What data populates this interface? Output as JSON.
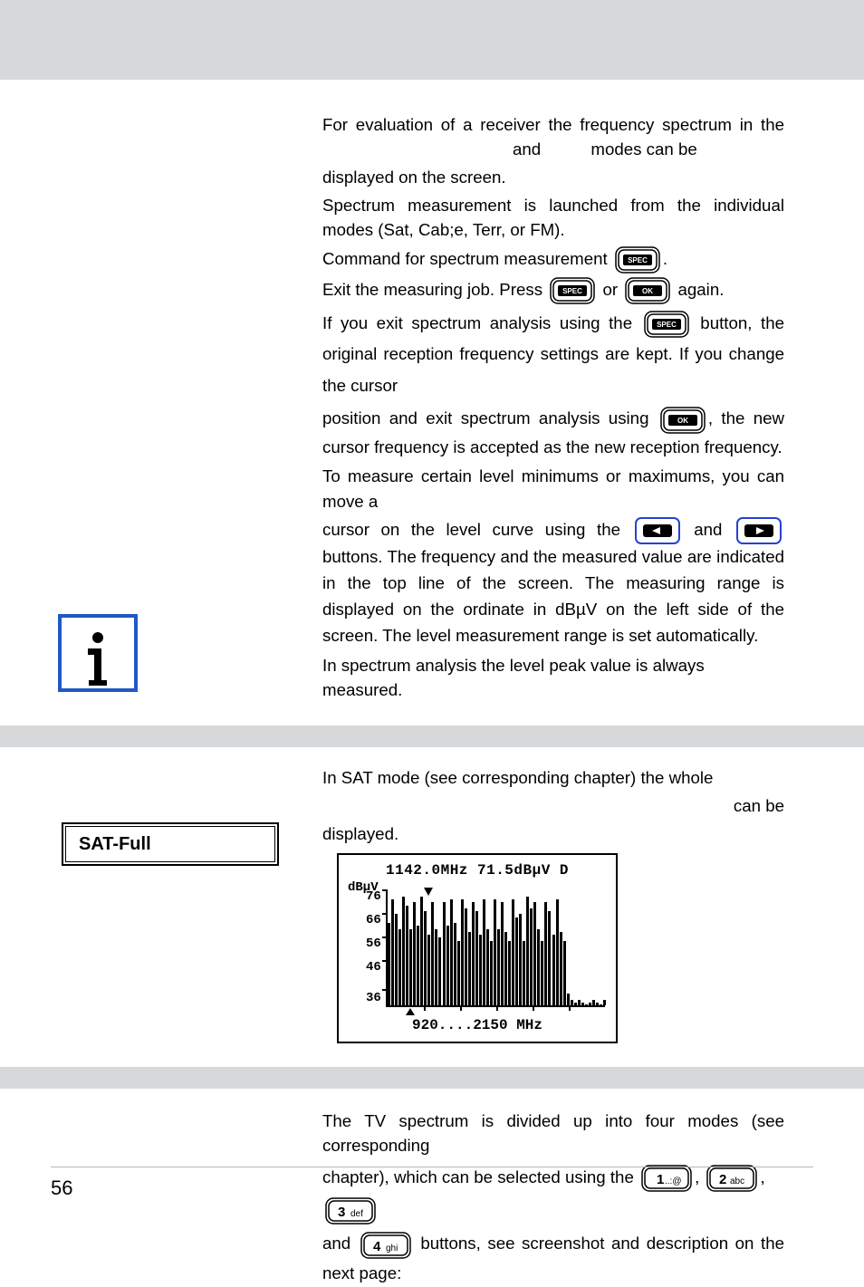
{
  "p1": "For evaluation of a receiver the frequency spectrum in the",
  "p1b": "and",
  "p1c": "modes can be",
  "p2": "displayed on the screen.",
  "p3": "Spectrum measurement is launched from the individual modes (Sat, Cab;e, Terr, or FM).",
  "p4": "Command for spectrum measurement",
  "p4dot": ".",
  "p5a": "Exit the measuring job. Press",
  "p5b": "or",
  "p5c": "again.",
  "p6a": "If you exit spectrum analysis using the",
  "p6b": "button, the original reception frequency settings are kept. If you change the cursor",
  "p7a": "position and exit spectrum analysis using",
  "p7b": ", the new cursor frequency is accepted as the new reception frequency.",
  "p8": "To measure certain level minimums or maximums, you can move a",
  "p9a": "cursor on the level curve using the",
  "p9b": "and",
  "p9c": "buttons. The frequency and the measured value are indicated in the top line of the screen. The measuring range is displayed on the ordinate in dBµV on the left side of the screen. The level measurement range is set automatically.",
  "p10": "In spectrum analysis the level peak value is always measured.",
  "p11": "In SAT mode (see corresponding chapter) the whole",
  "p11b": "can be",
  "p12": "displayed.",
  "sat_full_label": "SAT-Full",
  "chart_title": "1142.0MHz  71.5dBµV D",
  "chart_yunit": "dBµV",
  "chart_xlabel": "920....2150 MHz",
  "p13": "The TV spectrum is divided up into four modes (see corresponding",
  "p14a": "chapter), which can be selected using the",
  "p14comma1": ",",
  "p14comma2": ",",
  "p15a": "and",
  "p15b": "buttons, see screenshot and description on the next page:",
  "page_number": "56",
  "chart_data": {
    "type": "bar",
    "title": "1142.0MHz  71.5dBµV D",
    "ylabel": "dBµV",
    "ylim": [
      36,
      76
    ],
    "y_ticks": [
      36,
      46,
      56,
      66,
      76
    ],
    "xlabel": "920....2150 MHz",
    "cursor_freq": 1142.0,
    "cursor_level": 71.5,
    "values": [
      64,
      72,
      67,
      62,
      73,
      70,
      62,
      71,
      63,
      73,
      68,
      60,
      71,
      62,
      59,
      71,
      63,
      72,
      64,
      58,
      72,
      69,
      61,
      71,
      68,
      60,
      72,
      62,
      58,
      72,
      62,
      71,
      61,
      58,
      72,
      66,
      67,
      58,
      73,
      69,
      71,
      62,
      58,
      71,
      68,
      60,
      72,
      61,
      58,
      40,
      38,
      37,
      38,
      37,
      36,
      37,
      38,
      37,
      36,
      38
    ]
  },
  "keys": {
    "spec": "SPEC",
    "ok": "OK",
    "k1": "1..:@",
    "k2": "2abc",
    "k3": "3def",
    "k4": "4ghi"
  }
}
